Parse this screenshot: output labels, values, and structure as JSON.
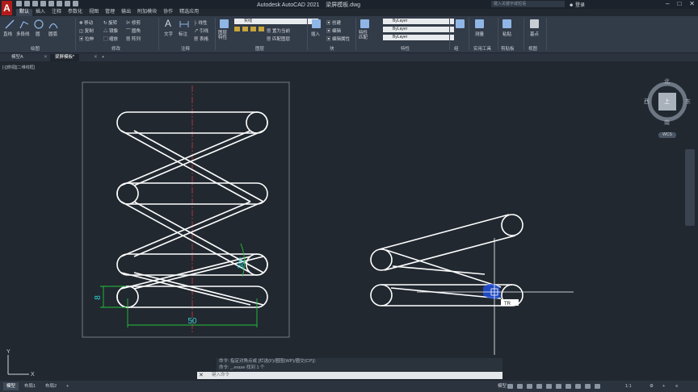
{
  "app": {
    "logo": "A",
    "title": "Autodesk AutoCAD 2021",
    "filename": "梁屏模板.dwg",
    "search_placeholder": "键入关键字或短语",
    "login": "登录"
  },
  "menu_tabs": [
    "默认",
    "插入",
    "注释",
    "参数化",
    "视图",
    "管理",
    "输出",
    "附加模块",
    "协作",
    "精选应用"
  ],
  "ribbon": {
    "draw": {
      "line": "直线",
      "polyline": "多段线",
      "circle": "圆",
      "arc": "圆弧",
      "label": "绘图"
    },
    "modify": {
      "move": "移动",
      "rotate": "旋转",
      "trim": "修剪",
      "copy": "复制",
      "mirror": "镜像",
      "fillet": "圆角",
      "stretch": "拉伸",
      "scale": "缩放",
      "array": "阵列",
      "label": "修改"
    },
    "annotation": {
      "text": "文字",
      "dimension": "标注",
      "linear": "线性",
      "leader": "引线",
      "table": "表格",
      "label": "注释"
    },
    "layers": {
      "properties": "图层特性",
      "current_layer": "实线",
      "make_current": "置为当前",
      "match_layer": "匹配图层",
      "label": "图层"
    },
    "block": {
      "insert": "插入",
      "create": "创建",
      "edit": "编辑",
      "edit_attr": "编辑属性",
      "label": "块"
    },
    "properties": {
      "match": "特性匹配",
      "color": "ByLayer",
      "linetype": "ByLayer",
      "lineweight": "ByLayer",
      "label": "特性"
    },
    "groups": {
      "label": "组"
    },
    "utilities": {
      "measure": "测量",
      "label": "实用工具"
    },
    "clipboard": {
      "paste": "粘贴",
      "label": "剪贴板"
    },
    "view": {
      "base": "基点",
      "label": "视图"
    }
  },
  "tr_tag": "TR",
  "doc_tabs": [
    "模型A",
    "梁屏模板*"
  ],
  "viewport_label": "[-][俯视][二维线框]",
  "drawing": {
    "dim_height": "8",
    "dim_width": "50",
    "dim_angle": "30°",
    "cursor_tooltip": "TR"
  },
  "viewcube": {
    "north": "北",
    "south": "南",
    "east": "东",
    "west": "西",
    "face": "上",
    "wcs": "WCS"
  },
  "command": {
    "history": [
      "命令: 指定对角点或 [栏选(F)/圈围(WP)/圈交(CP)]:",
      "命令: _.erase 找到 1 个"
    ],
    "placeholder": "键入命令"
  },
  "status": {
    "layout_tabs": [
      "模型",
      "布局1",
      "布局2"
    ],
    "model_label": "模型",
    "scale": "1:1"
  },
  "colors": {
    "accent_red": "#e0221b",
    "dim_green": "#22c33a",
    "dim_text": "#2bd3d3",
    "centerline": "#d23a3a",
    "highlight": "#1f4fd8"
  }
}
